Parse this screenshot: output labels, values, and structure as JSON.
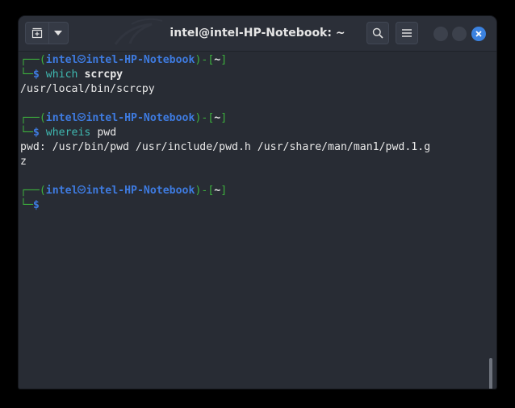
{
  "window": {
    "title": "intel@intel-HP-Notebook: ~"
  },
  "prompt": {
    "prefix_top": "┌──(",
    "user": "intel",
    "host": "intel-HP-Notebook",
    "mid": ")-[",
    "dir": "~",
    "suffix": "]",
    "prefix_bottom": "└─",
    "symbol": "$"
  },
  "session": [
    {
      "command_name": "which",
      "command_args": "scrcpy",
      "output": [
        "/usr/local/bin/scrcpy"
      ]
    },
    {
      "command_name": "whereis",
      "command_args": "pwd",
      "output": [
        "pwd: /usr/bin/pwd /usr/include/pwd.h /usr/share/man/man1/pwd.1.g",
        "z"
      ]
    }
  ],
  "colors": {
    "background": "#282c34",
    "prompt_frame": "#3db13d",
    "prompt_user_host": "#3e7be0",
    "command": "#3fb8b0",
    "text": "#e8e8e8",
    "close_button": "#3b82e0"
  },
  "icons": {
    "new_tab": "new-tab-icon",
    "tab_menu": "chevron-down-icon",
    "search": "search-icon",
    "menu": "hamburger-menu-icon",
    "minimize": "minimize-icon",
    "maximize": "maximize-icon",
    "close": "close-icon"
  }
}
